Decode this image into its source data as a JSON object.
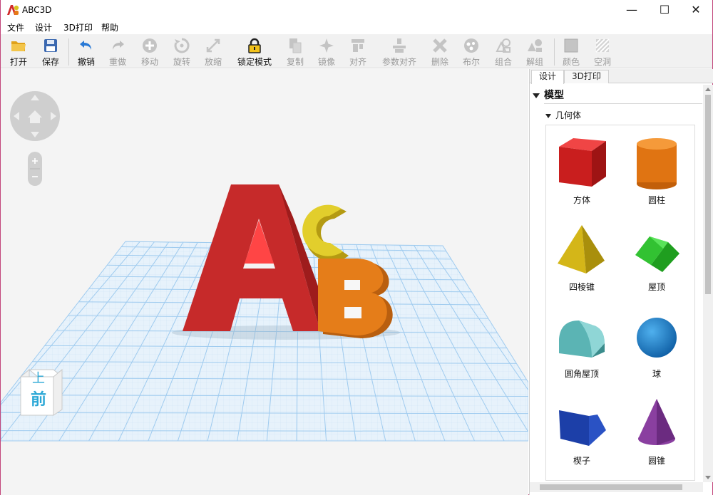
{
  "window": {
    "title": "ABC3D"
  },
  "menu": [
    "文件",
    "设计",
    "3D打印",
    "帮助"
  ],
  "toolbar": {
    "open": "打开",
    "save": "保存",
    "undo": "撤销",
    "redo": "重做",
    "move": "移动",
    "rotate": "旋转",
    "scale": "放缩",
    "lock": "锁定模式",
    "copy": "复制",
    "mirror": "镜像",
    "align": "对齐",
    "param_align": "参数对齐",
    "delete": "删除",
    "boolean": "布尔",
    "group": "组合",
    "ungroup": "解组",
    "color": "颜色",
    "hole": "空洞"
  },
  "viewcube": {
    "top": "上",
    "front": "前"
  },
  "panel": {
    "tabs": [
      "设计",
      "3D打印"
    ],
    "section": "模型",
    "subsection": "几何体",
    "shapes": [
      "方体",
      "圆柱",
      "四棱锥",
      "屋顶",
      "圆角屋顶",
      "球",
      "楔子",
      "圆锥"
    ]
  },
  "scene": {
    "letters": [
      "A",
      "C",
      "B"
    ]
  },
  "colors": {
    "accent": "#2a7ad6",
    "letter_a": "#d12b2b",
    "letter_b": "#e67a16",
    "letter_c": "#d8c21e",
    "grid": "#b9d9f2"
  }
}
